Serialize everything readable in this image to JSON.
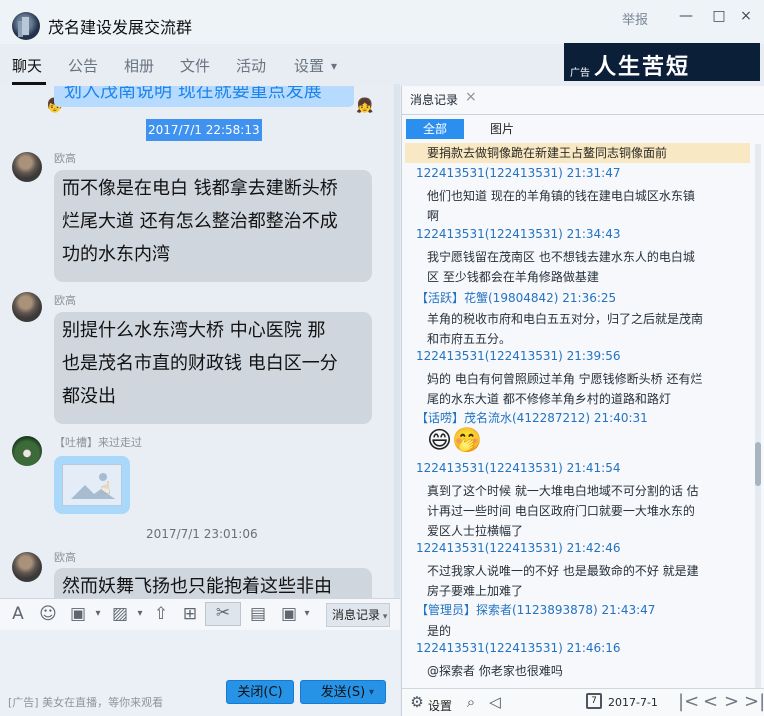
{
  "title": "茂名建设发展交流群",
  "report": "举报",
  "tabs": [
    "聊天",
    "公告",
    "相册",
    "文件",
    "活动",
    "设置"
  ],
  "ad": {
    "small": "广告",
    "title": "人生苦短"
  },
  "chat": {
    "top_message": "划入茂南说明   现在就要重点发展",
    "times": [
      "2017/7/1 22:58:13",
      "2017/7/1 23:01:06"
    ],
    "messages": [
      {
        "sender": "欧高",
        "text": [
          "而不像是在电白 钱都拿去建断头桥",
          "烂尾大道 还有怎么整治都整治不成",
          "功的水东内湾"
        ]
      },
      {
        "sender": "欧高",
        "text": [
          "别提什么水东湾大桥 中心医院 那",
          "也是茂名市直的财政钱 电白区一分",
          "都没出"
        ]
      },
      {
        "sender": "【吐槽】来过走过"
      },
      {
        "sender": "欧高",
        "text": [
          "然而妖舞飞扬也只能抱着这些非由"
        ]
      }
    ]
  },
  "toolbar": {
    "msgrec_label": "消息记录"
  },
  "compose": {
    "ad_text": "[广告] 美女在直播，等你来观看",
    "close_label": "关闭(C)",
    "send_label": "发送(S)"
  },
  "right": {
    "title": "消息记录",
    "segments": [
      "全部",
      "图片"
    ],
    "highlight": "要捐款去做铜像跪在新建王占鳌同志铜像面前",
    "entries": [
      {
        "head": "122413531(122413531) 21:31:47",
        "body": [
          "他们也知道 现在的羊角镇的钱在建电白城区水东镇",
          "啊"
        ]
      },
      {
        "head": "122413531(122413531) 21:34:43",
        "body": [
          "我宁愿钱留在茂南区 也不想钱去建水东人的电白城",
          "区 至少钱都会在羊角修路做基建"
        ]
      },
      {
        "head": "【活跃】花蟹(19804842) 21:36:25",
        "body": [
          "羊角的税收市府和电白五五对分，归了之后就是茂南",
          "和市府五五分。"
        ]
      },
      {
        "head": "122413531(122413531) 21:39:56",
        "body": [
          "妈的 电白有何曾照顾过羊角 宁愿钱修断头桥 还有烂",
          "尾的水东大道 都不修修羊角乡村的道路和路灯"
        ]
      },
      {
        "head": "【话唠】茂名流水(412287212) 21:40:31",
        "body": []
      },
      {
        "head": "122413531(122413531) 21:41:54",
        "body": [
          "真到了这个时候 就一大堆电白地域不可分割的话 估",
          "计再过一些时间 电白区政府门口就要一大堆水东的",
          "爱区人士拉横幅了"
        ]
      },
      {
        "head": "122413531(122413531) 21:42:46",
        "body": [
          "不过我家人说唯一的不好 也是最致命的不好 就是建",
          "房子要难上加难了"
        ]
      },
      {
        "head": "【管理员】探索者(1123893878) 21:43:47",
        "body": [
          "是的"
        ]
      },
      {
        "head": "122413531(122413531) 21:46:16",
        "body": [
          "@探索者 你老家也很难吗"
        ]
      }
    ],
    "settings_label": "设置",
    "date": "2017-7-1",
    "calendar_day": "7"
  }
}
